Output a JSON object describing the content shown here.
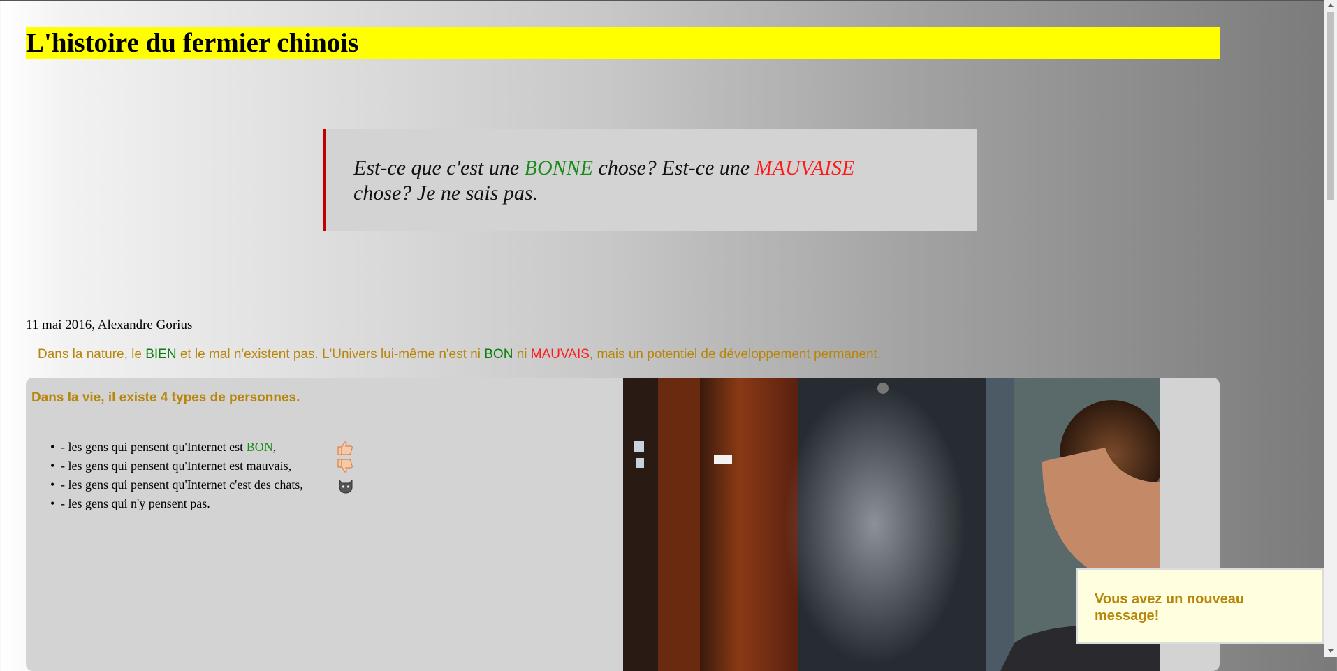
{
  "page": {
    "title": "L'histoire du fermier chinois"
  },
  "quote": {
    "part1": "Est-ce que c'est une ",
    "good": "BONNE",
    "part2": " chose? Est-ce une ",
    "bad": "MAUVAISE",
    "part3": " chose? Je ne sais pas."
  },
  "byline": "11 mai 2016, Alexandre Gorius",
  "intro": {
    "p1": "Dans la nature, le ",
    "bien": "BIEN",
    "p2": " et le mal n'existent pas. L'Univers lui-même n'est ni ",
    "bon": "BON",
    "p3": " ni ",
    "mauvais": "MAUVAIS",
    "p4": ", mais un potentiel de développement permanent."
  },
  "section": {
    "title": "Dans la vie, il existe 4 types de personnes.",
    "items": [
      {
        "text": "- les gens qui pensent qu'Internet est ",
        "highlight": "BON",
        "suffix": ",",
        "icon": "thumbs-up-icon"
      },
      {
        "text": "- les gens qui pensent qu'Internet est mauvais,",
        "icon": "thumbs-down-icon"
      },
      {
        "text": "- les gens qui pensent qu'Internet c'est des chats,",
        "icon": "cat-icon"
      },
      {
        "text": "- les gens qui n'y pensent pas."
      }
    ]
  },
  "notification": {
    "message": "Vous avez un nouveau message!"
  },
  "colors": {
    "title_bg": "#ffff00",
    "good": "#1a8a1a",
    "bad": "#ff1a1a",
    "accent": "#b8860b"
  }
}
